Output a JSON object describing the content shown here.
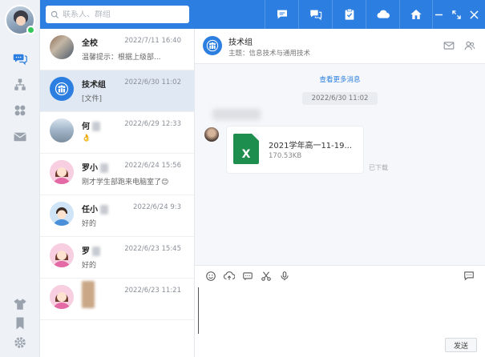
{
  "search": {
    "placeholder": "联系人、群组"
  },
  "conversations": [
    {
      "name": "全校",
      "time": "2022/7/11 16:40",
      "preview": "温馨提示：根据上级部..."
    },
    {
      "name": "技术组",
      "time": "2022/6/30 11:02",
      "preview": "[文件]"
    },
    {
      "name": "何",
      "time": "2022/6/29 12:33",
      "preview": "👌"
    },
    {
      "name": "罗小",
      "time": "2022/6/24 15:56",
      "preview": "刚才学生部跑来电脑室了😊"
    },
    {
      "name": "任小",
      "time": "2022/6/24 9:3",
      "preview": "好的"
    },
    {
      "name": "罗",
      "time": "2022/6/23 15:45",
      "preview": "好的"
    },
    {
      "name": "",
      "time": "2022/6/23 11:21",
      "preview": ""
    }
  ],
  "chat": {
    "title": "技术组",
    "topic": "主题：信息技术与通用技术",
    "more_messages": "查看更多消息",
    "date": "2022/6/30 11:02",
    "file": {
      "name": "2021学年高一11-19...",
      "size": "170.53KB",
      "icon_letter": "X"
    },
    "downloaded": "已下载",
    "send_label": "发送"
  },
  "colors": {
    "accent": "#2c7fe0",
    "active_item": "#dfe8f3",
    "online": "#34c759",
    "excel": "#1e8e4e"
  }
}
